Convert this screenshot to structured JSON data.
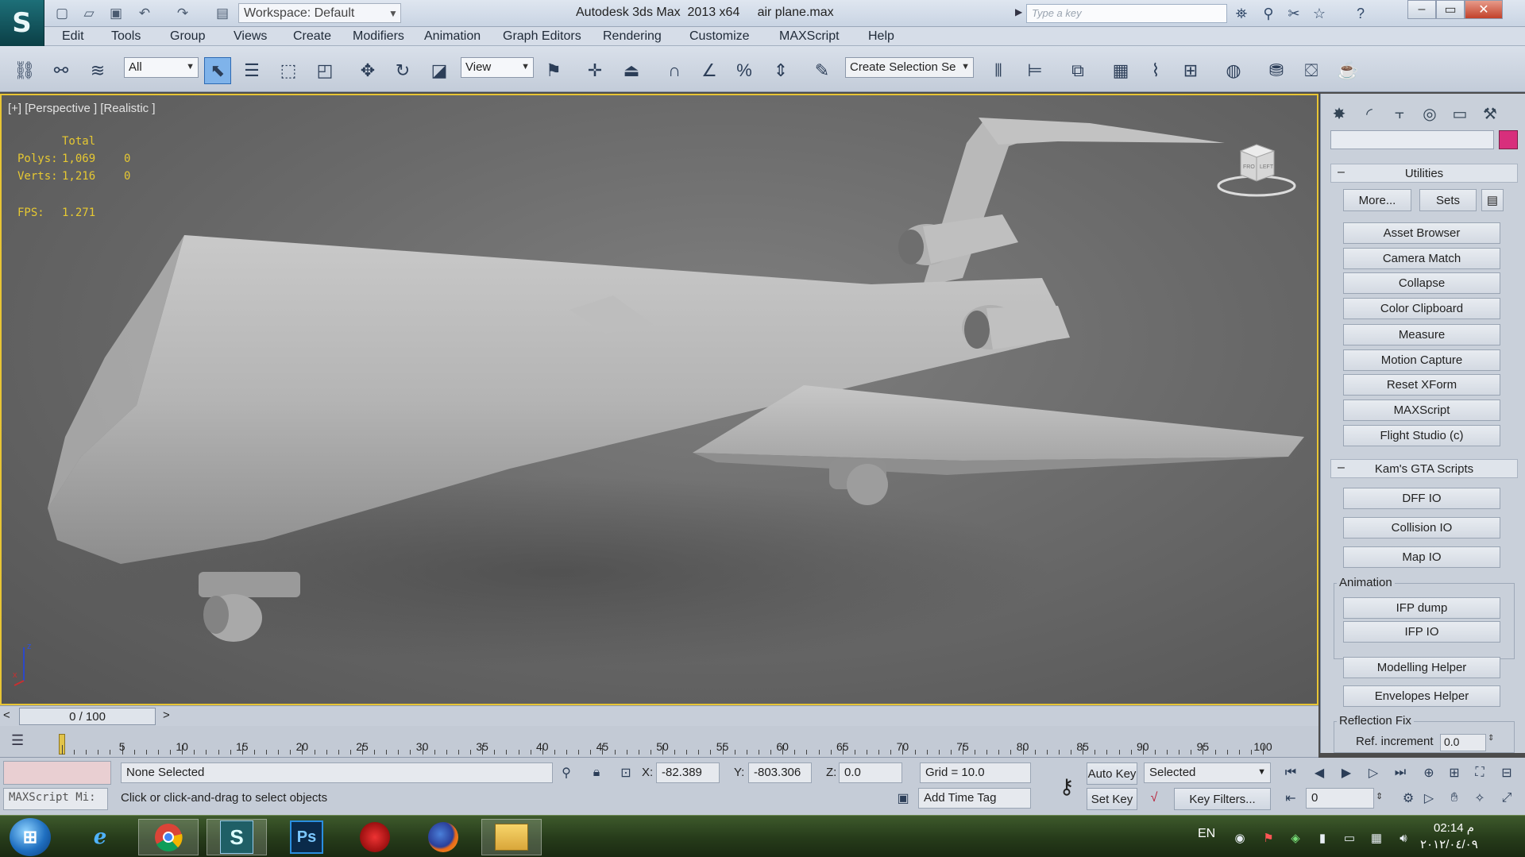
{
  "window": {
    "app_logo": "S",
    "workspace_label": "Workspace: Default",
    "title": "Autodesk 3ds Max  2013 x64     air plane.max",
    "search_placeholder": "Type a key",
    "buttons": {
      "minimize": "–",
      "maximize": "▭",
      "close": "✕"
    }
  },
  "menu": [
    "Edit",
    "Tools",
    "Group",
    "Views",
    "Create",
    "Modifiers",
    "Animation",
    "Graph Editors",
    "Rendering",
    "Customize",
    "MAXScript",
    "Help"
  ],
  "toolbar": {
    "selection_filter": "All",
    "reference_coord": "View",
    "named_selection": "Create Selection Se"
  },
  "viewport": {
    "label": "[+] [Perspective ] [Realistic ]",
    "stats": {
      "total_header": "Total",
      "polys_label": "Polys:",
      "polys_value": "1,069",
      "polys_selected": "0",
      "verts_label": "Verts:",
      "verts_value": "1,216",
      "verts_selected": "0",
      "fps_label": "FPS:",
      "fps_value": "1.271"
    },
    "axis": {
      "z": "z",
      "x": "x"
    },
    "viewcube_faces": {
      "front": "FRO",
      "left": "LEFT"
    }
  },
  "command_panel": {
    "utilities_title": "Utilities",
    "more_button": "More...",
    "sets_button": "Sets",
    "utilities": [
      "Asset Browser",
      "Camera Match",
      "Collapse",
      "Color Clipboard",
      "Measure",
      "Motion Capture",
      "Reset XForm",
      "MAXScript",
      "Flight Studio (c)"
    ],
    "gta_title": "Kam's GTA Scripts",
    "gta_buttons": [
      "DFF IO",
      "Collision IO",
      "Map IO"
    ],
    "animation_group": "Animation",
    "animation_buttons": [
      "IFP dump",
      "IFP IO"
    ],
    "helpers": [
      "Modelling Helper",
      "Envelopes Helper"
    ],
    "reflection_group": "Reflection Fix",
    "ref_increment_label": "Ref. increment",
    "ref_increment_value": "0.0"
  },
  "timeline": {
    "frame_display": "0 / 100",
    "prev": "<",
    "next": ">",
    "tick_labels": [
      "5",
      "10",
      "15",
      "20",
      "25",
      "30",
      "35",
      "40",
      "45",
      "50",
      "55",
      "60",
      "65",
      "70",
      "75",
      "80",
      "85",
      "90",
      "95",
      "100"
    ]
  },
  "status": {
    "maxscript_listener": "MAXScript Mi:",
    "selection": "None Selected",
    "prompt": "Click or click-and-drag to select objects",
    "x_label": "X:",
    "x_value": "-82.389",
    "y_label": "Y:",
    "y_value": "-803.306",
    "z_label": "Z:",
    "z_value": "0.0",
    "grid": "Grid = 10.0",
    "add_time_tag": "Add Time Tag",
    "auto_key": "Auto Key",
    "auto_key_mode": "Selected",
    "set_key": "Set Key",
    "key_filters": "Key Filters...",
    "current_frame": "0"
  },
  "taskbar": {
    "apps": [
      "ie-icon",
      "chrome-icon",
      "3dsmax-icon",
      "photoshop-icon",
      "app-icon",
      "firefox-icon",
      "explorer-icon"
    ],
    "ps_label": "Ps",
    "language": "EN",
    "time": "02:14 م",
    "date": "٢٠١٢/٠٤/٠٩"
  },
  "colors": {
    "viewport_border": "#e8c534",
    "stats_text": "#e6c832",
    "object_color": "#d82f7c",
    "active_tool": "#7fb3ea"
  }
}
